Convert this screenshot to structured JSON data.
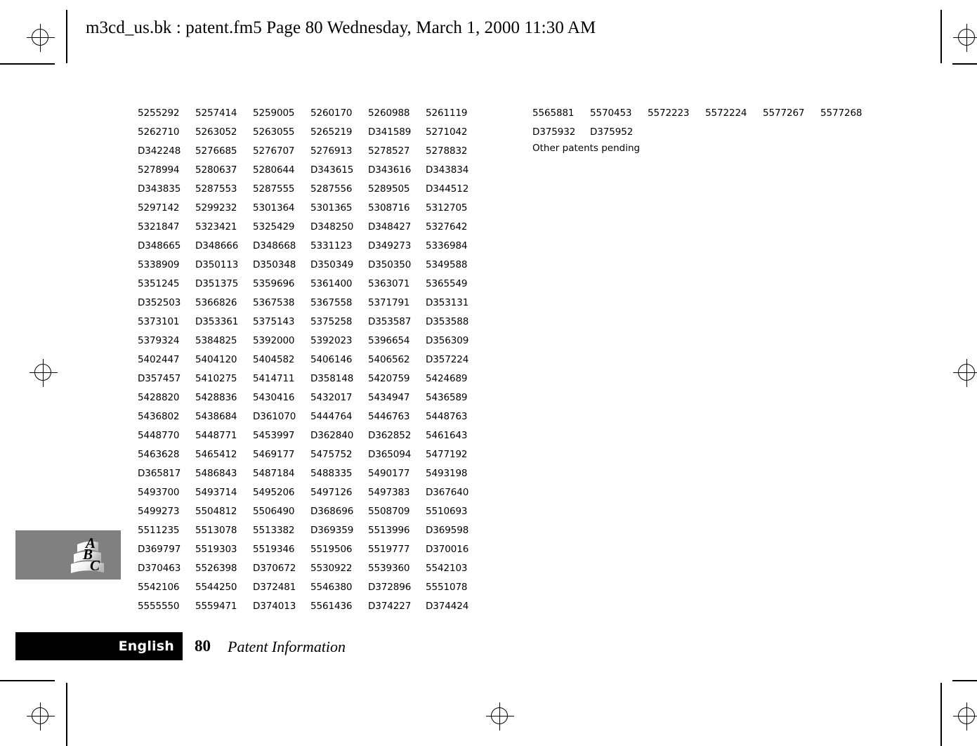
{
  "file_header": "m3cd_us.bk : patent.fm5  Page 80  Wednesday, March 1, 2000  11:30 AM",
  "patent_table_left": [
    [
      "5255292",
      "5257414",
      "5259005",
      "5260170",
      "5260988",
      "5261119"
    ],
    [
      "5262710",
      "5263052",
      "5263055",
      "5265219",
      "D341589",
      "5271042"
    ],
    [
      "D342248",
      "5276685",
      "5276707",
      "5276913",
      "5278527",
      "5278832"
    ],
    [
      "5278994",
      "5280637",
      "5280644",
      "D343615",
      "D343616",
      "D343834"
    ],
    [
      "D343835",
      "5287553",
      "5287555",
      "5287556",
      "5289505",
      "D344512"
    ],
    [
      "5297142",
      "5299232",
      "5301364",
      "5301365",
      "5308716",
      "5312705"
    ],
    [
      "5321847",
      "5323421",
      "5325429",
      "D348250",
      "D348427",
      "5327642"
    ],
    [
      "D348665",
      "D348666",
      "D348668",
      "5331123",
      "D349273",
      "5336984"
    ],
    [
      "5338909",
      "D350113",
      "D350348",
      "D350349",
      "D350350",
      "5349588"
    ],
    [
      "5351245",
      "D351375",
      "5359696",
      "5361400",
      "5363071",
      "5365549"
    ],
    [
      "D352503",
      "5366826",
      "5367538",
      "5367558",
      "5371791",
      "D353131"
    ],
    [
      "5373101",
      "D353361",
      "5375143",
      "5375258",
      "D353587",
      "D353588"
    ],
    [
      "5379324",
      "5384825",
      "5392000",
      "5392023",
      "5396654",
      "D356309"
    ],
    [
      "5402447",
      "5404120",
      "5404582",
      "5406146",
      "5406562",
      "D357224"
    ],
    [
      "D357457",
      "5410275",
      "5414711",
      "D358148",
      "5420759",
      "5424689"
    ],
    [
      "5428820",
      "5428836",
      "5430416",
      "5432017",
      "5434947",
      "5436589"
    ],
    [
      "5436802",
      "5438684",
      "D361070",
      "5444764",
      "5446763",
      "5448763"
    ],
    [
      "5448770",
      "5448771",
      "5453997",
      "D362840",
      "D362852",
      "5461643"
    ],
    [
      "5463628",
      "5465412",
      "5469177",
      "5475752",
      "D365094",
      "5477192"
    ],
    [
      "D365817",
      "5486843",
      "5487184",
      "5488335",
      "5490177",
      "5493198"
    ],
    [
      "5493700",
      "5493714",
      "5495206",
      "5497126",
      "5497383",
      "D367640"
    ],
    [
      "5499273",
      "5504812",
      "5506490",
      "D368696",
      "5508709",
      "5510693"
    ],
    [
      "5511235",
      "5513078",
      "5513382",
      "D369359",
      "5513996",
      "D369598"
    ],
    [
      "D369797",
      "5519303",
      "5519346",
      "5519506",
      "5519777",
      "D370016"
    ],
    [
      "D370463",
      "5526398",
      "D370672",
      "5530922",
      "5539360",
      "5542103"
    ],
    [
      "5542106",
      "5544250",
      "D372481",
      "5546380",
      "D372896",
      "5551078"
    ],
    [
      "5555550",
      "5559471",
      "D374013",
      "5561436",
      "D374227",
      "D374424"
    ]
  ],
  "patent_table_right": [
    [
      "5565881",
      "5570453",
      "5572223",
      "5572224",
      "5577267",
      "5577268"
    ],
    [
      "D375932",
      "D375952",
      "",
      "",
      "",
      ""
    ]
  ],
  "other_patents_note": "Other patents pending",
  "logo": {
    "letters": [
      "A",
      "B",
      "C"
    ],
    "background_color": "#808080"
  },
  "footer": {
    "language": "English",
    "page_number": "80",
    "section_title": "Patent Information",
    "bar_color": "#000000"
  }
}
